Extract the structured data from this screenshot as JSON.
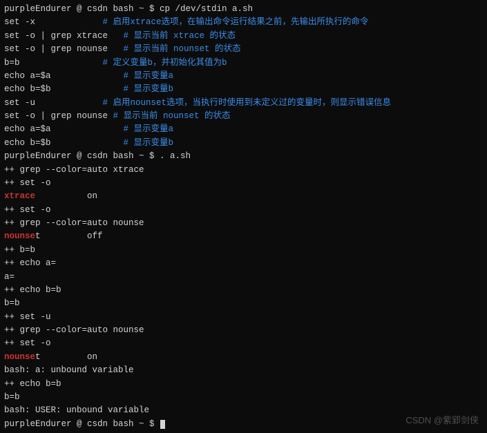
{
  "prompt1": "purpleEndurer @ csdn bash ~ $ cp /dev/stdin a.sh",
  "script": [
    {
      "cmd": "set -x             ",
      "comment": "# 启用xtrace选项，在输出命令运行结果之前，先输出所执行的命令"
    },
    {
      "cmd": "set -o | grep xtrace   ",
      "comment": "# 显示当前 xtrace 的状态"
    },
    {
      "cmd": "set -o | grep nounse   ",
      "comment": "# 显示当前 nounset 的状态"
    },
    {
      "cmd": "b=b                ",
      "comment": "# 定义变量b，并初始化其值为b"
    },
    {
      "cmd": "echo a=$a              ",
      "comment": "# 显示变量a"
    },
    {
      "cmd": "echo b=$b              ",
      "comment": "# 显示变量b"
    },
    {
      "cmd": "set -u             ",
      "comment": "# 启用nounset选项，当执行时使用到未定义过的变量时，则显示错误信息"
    },
    {
      "cmd": "set -o | grep nounse ",
      "comment": "# 显示当前 nounset 的状态"
    },
    {
      "cmd": "echo a=$a              ",
      "comment": "# 显示变量a"
    },
    {
      "cmd": "echo b=$b              ",
      "comment": "# 显示变量b"
    }
  ],
  "prompt2": "purpleEndurer @ csdn bash ~ $ . a.sh",
  "out": [
    {
      "t": "plain",
      "text": "++ grep --color=auto xtrace"
    },
    {
      "t": "plain",
      "text": "++ set -o"
    },
    {
      "t": "match",
      "match": "xtrace",
      "tail": "          on"
    },
    {
      "t": "plain",
      "text": "++ set -o"
    },
    {
      "t": "plain",
      "text": "++ grep --color=auto nounse"
    },
    {
      "t": "match",
      "match": "nounse",
      "tail": "t         off"
    },
    {
      "t": "plain",
      "text": "++ b=b"
    },
    {
      "t": "plain",
      "text": "++ echo a="
    },
    {
      "t": "plain",
      "text": "a="
    },
    {
      "t": "plain",
      "text": "++ echo b=b"
    },
    {
      "t": "plain",
      "text": "b=b"
    },
    {
      "t": "plain",
      "text": "++ set -u"
    },
    {
      "t": "plain",
      "text": "++ grep --color=auto nounse"
    },
    {
      "t": "plain",
      "text": "++ set -o"
    },
    {
      "t": "match",
      "match": "nounse",
      "tail": "t         on"
    },
    {
      "t": "plain",
      "text": "bash: a: unbound variable"
    },
    {
      "t": "plain",
      "text": "++ echo b=b"
    },
    {
      "t": "plain",
      "text": "b=b"
    },
    {
      "t": "plain",
      "text": "bash: USER: unbound variable"
    }
  ],
  "prompt3": "purpleEndurer @ csdn bash ~ $ ",
  "watermark": "CSDN @紫郢剑侠"
}
